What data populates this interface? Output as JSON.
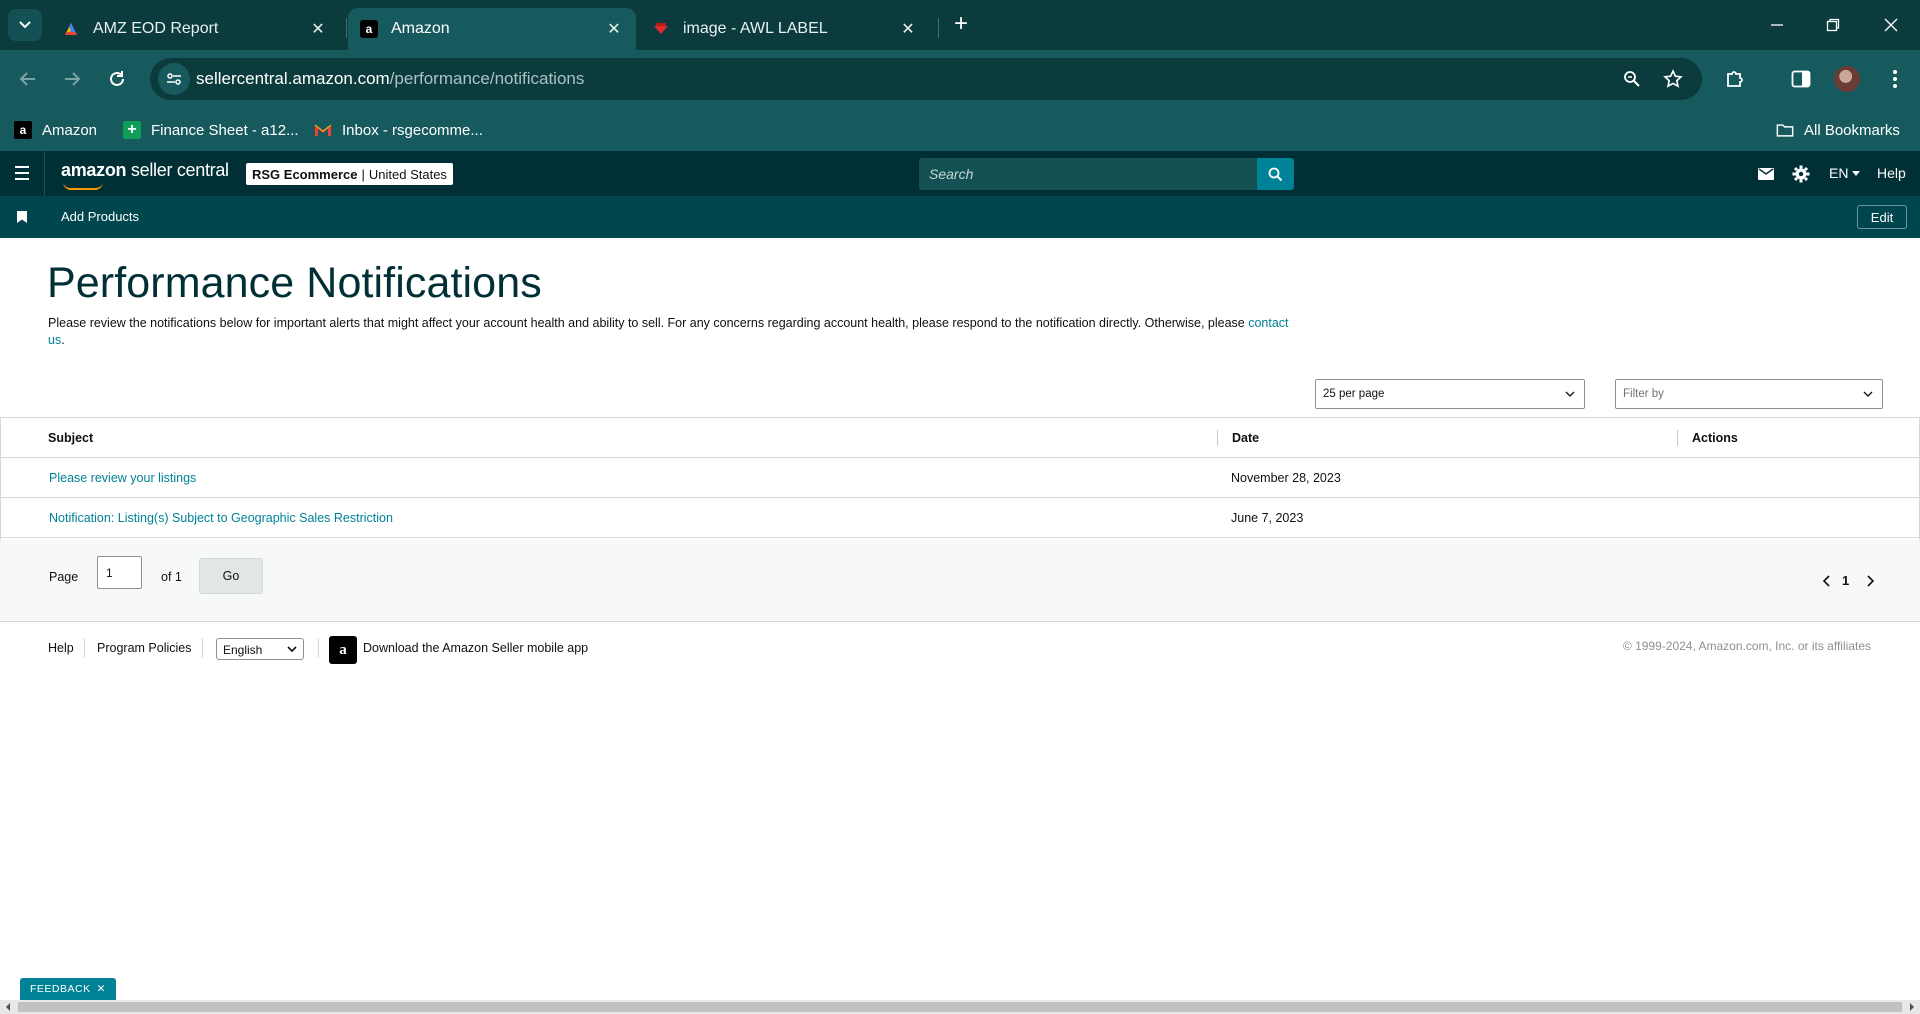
{
  "browser": {
    "tabs": [
      {
        "title": "AMZ EOD Report",
        "favicon": "sheets-colorful-icon",
        "active": false
      },
      {
        "title": "Amazon",
        "favicon": "amazon-a-icon",
        "active": true
      },
      {
        "title": "image - AWL LABEL",
        "favicon": "red-label-icon",
        "active": false
      }
    ],
    "new_tab_label": "+",
    "url_domain": "sellercentral.amazon.com",
    "url_path": "/performance/notifications",
    "bookmarks": [
      {
        "label": "Amazon",
        "icon": "amazon-a-icon"
      },
      {
        "label": "Finance Sheet - a12...",
        "icon": "sheets-plus-icon"
      },
      {
        "label": "Inbox - rsgecomme...",
        "icon": "gmail-icon"
      }
    ],
    "all_bookmarks_label": "All Bookmarks"
  },
  "header": {
    "logo_prefix": "amazon",
    "logo_suffix": " seller central",
    "store_name": "RSG Ecommerce",
    "store_sep": "|",
    "store_region": "United States",
    "search_placeholder": "Search",
    "language": "EN",
    "help_label": "Help",
    "colors": {
      "bar": "#002f36",
      "subnav": "#00464f",
      "accent": "#008296"
    }
  },
  "subnav": {
    "pinned_item": "Add Products",
    "edit_label": "Edit"
  },
  "main": {
    "title": "Performance Notifications",
    "intro_text": "Please review the notifications below for important alerts that might affect your account health and ability to sell. For any concerns regarding account health, please respond to the notification directly. Otherwise, please ",
    "intro_link": "contact us",
    "intro_end": ".",
    "per_page_value": "25 per page",
    "filter_placeholder": "Filter by",
    "table": {
      "columns": [
        "Subject",
        "Date",
        "Actions"
      ],
      "rows": [
        {
          "subject": "Please review your listings",
          "date": "November 28, 2023",
          "actions": ""
        },
        {
          "subject": "Notification: Listing(s) Subject to Geographic Sales Restriction",
          "date": "June 7, 2023",
          "actions": ""
        }
      ]
    },
    "pager": {
      "page_label": "Page",
      "page_value": "1",
      "of_label": "of 1",
      "go_label": "Go",
      "current_page": "1"
    }
  },
  "footer": {
    "help": "Help",
    "policies": "Program Policies",
    "language": "English",
    "app_text": "Download the Amazon Seller mobile app",
    "copyright": "© 1999-2024, Amazon.com, Inc. or its affiliates"
  },
  "feedback_label": "FEEDBACK"
}
